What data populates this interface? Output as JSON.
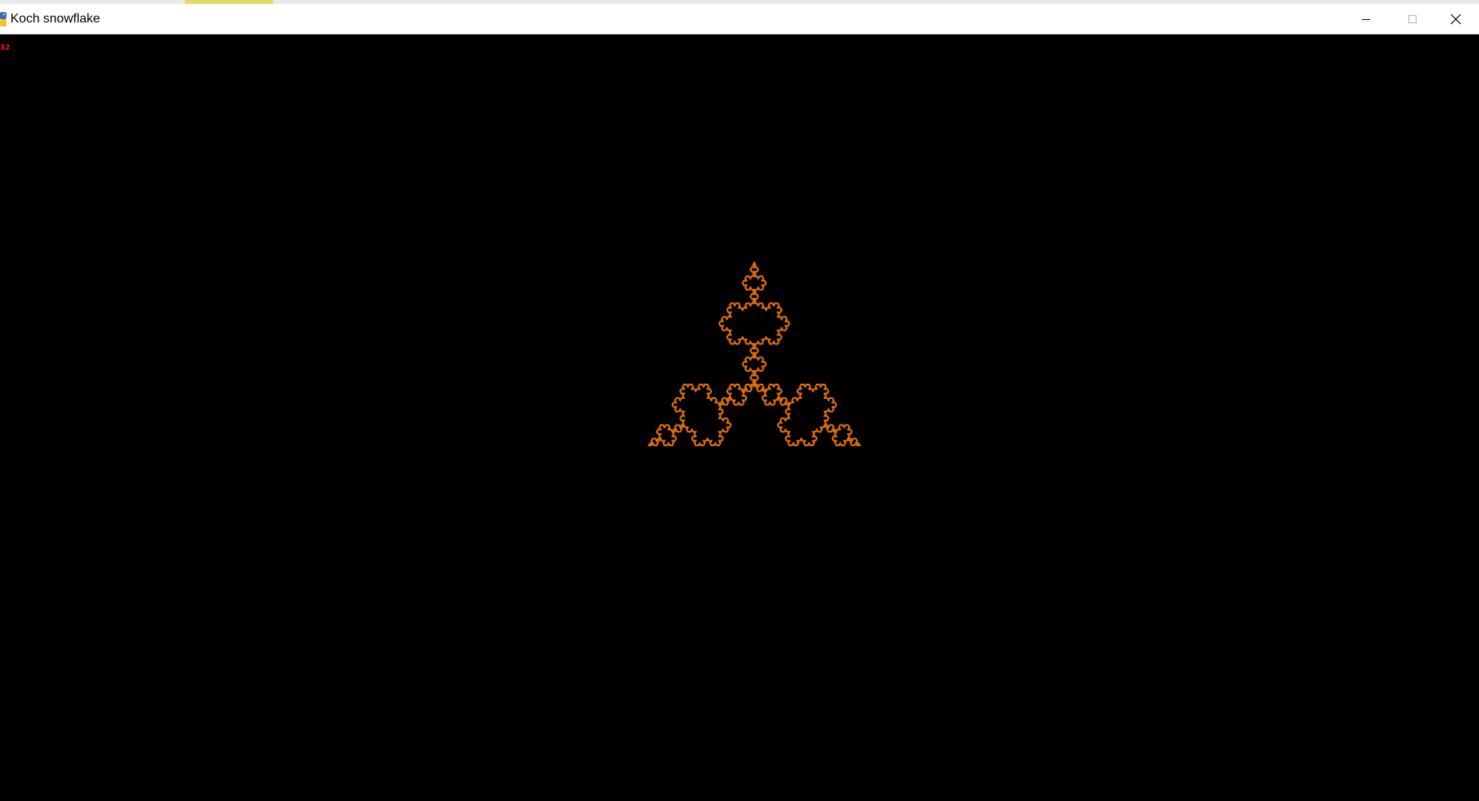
{
  "window": {
    "title": "Koch snowflake",
    "app_icon": "python-icon",
    "controls": {
      "minimize_icon": "minimize-icon",
      "maximize_icon": "maximize-icon",
      "close_icon": "close-icon"
    }
  },
  "canvas": {
    "background": "#000000",
    "fps_text": "32",
    "fps_color": "#ff1a1a"
  },
  "snowflake": {
    "color": "#e8720c",
    "iterations": 4
  }
}
